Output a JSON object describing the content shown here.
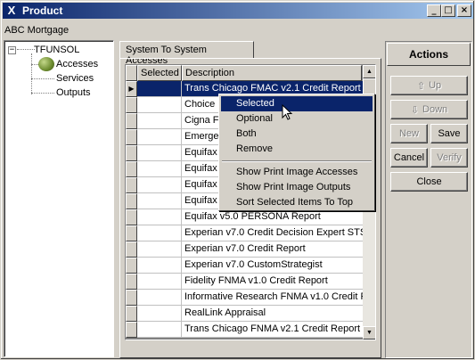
{
  "window": {
    "title": "Product",
    "title_icon": "X"
  },
  "title_buttons": {
    "minimize": "_",
    "maximize": "□",
    "close": "×"
  },
  "company": "ABC Mortgage",
  "tree": {
    "root": "TFUNSOL",
    "expander": "−",
    "children": [
      "Accesses",
      "Services",
      "Outputs"
    ]
  },
  "tab": {
    "label": "System To System Accesses"
  },
  "grid": {
    "columns": [
      "Selected",
      "Description"
    ],
    "current_row_marker": "▶",
    "rows": [
      "Trans Chicago FMAC v2.1 Credit Report",
      "Choice Data",
      "Cigna Flood",
      "Emergent",
      "Equifax",
      "Equifax",
      "Equifax",
      "Equifax",
      "Equifax v5.0 PERSONA Report",
      "Experian v7.0 Credit Decision Expert STS",
      "Experian v7.0 Credit Report",
      "Experian v7.0 CustomStrategist",
      "Fidelity FNMA v1.0 Credit Report",
      "Informative Research FNMA v1.0 Credit Report",
      "RealLink Appraisal",
      "Trans Chicago FNMA v2.1 Credit Report"
    ]
  },
  "context_menu": {
    "items": [
      "Selected",
      "Optional",
      "Both",
      "Remove"
    ],
    "items2": [
      "Show Print Image Accesses",
      "Show Print Image Outputs",
      "Sort Selected Items To Top"
    ],
    "highlighted": "Selected"
  },
  "actions": {
    "title": "Actions",
    "up": "Up",
    "down": "Down",
    "new": "New",
    "save": "Save",
    "cancel": "Cancel",
    "verify": "Verify",
    "close": "Close"
  },
  "colors": {
    "titlebar": "#0a246a",
    "face": "#d4d0c8",
    "highlight": "#0a246a"
  }
}
